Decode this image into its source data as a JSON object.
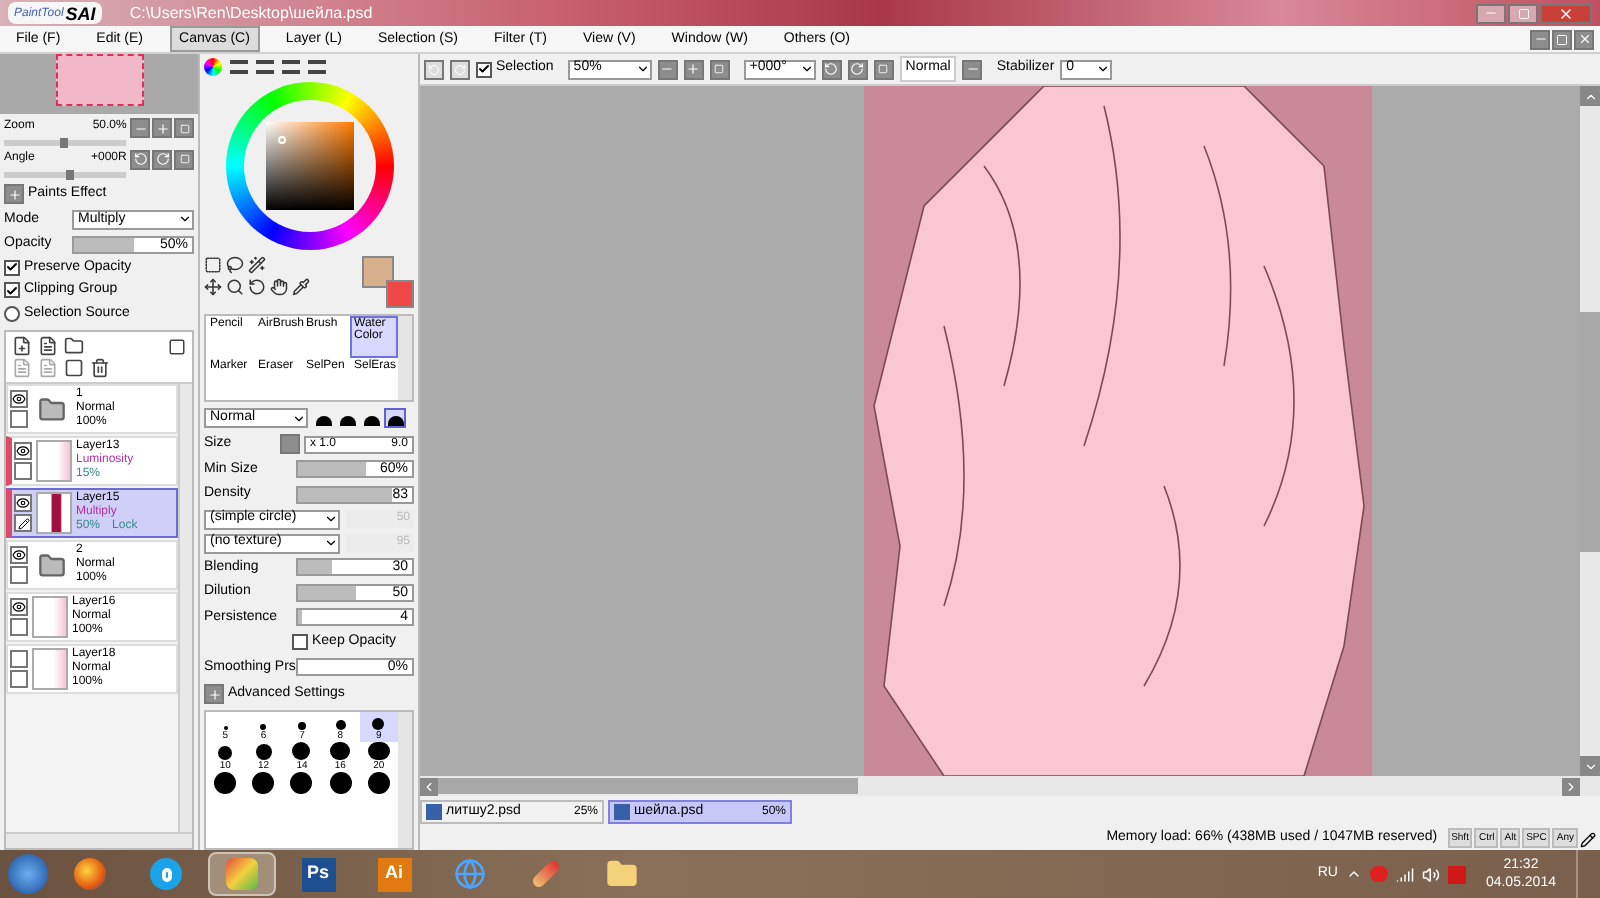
{
  "window": {
    "logo_small": "PaintTool",
    "logo_big": "SAI",
    "title": "C:\\Users\\Ren\\Desktop\\шейла.psd"
  },
  "menu": [
    {
      "label": "File (F)",
      "selected": false
    },
    {
      "label": "Edit (E)",
      "selected": false
    },
    {
      "label": "Canvas (C)",
      "selected": true
    },
    {
      "label": "Layer (L)",
      "selected": false
    },
    {
      "label": "Selection (S)",
      "selected": false
    },
    {
      "label": "Filter (T)",
      "selected": false
    },
    {
      "label": "View (V)",
      "selected": false
    },
    {
      "label": "Window (W)",
      "selected": false
    },
    {
      "label": "Others (O)",
      "selected": false
    }
  ],
  "toolbar": {
    "selection": {
      "label": "Selection",
      "checked": true
    },
    "zoom": "50%",
    "angle": "+000°",
    "blend": "Normal",
    "stabilizer_label": "Stabilizer",
    "stabilizer": "0"
  },
  "navigator": {
    "zoom": {
      "label": "Zoom",
      "value": "50.0%",
      "level": 0.45
    },
    "angle": {
      "label": "Angle",
      "value": "+000R",
      "level": 0.5
    }
  },
  "layer_properties": {
    "title": "Paints Effect",
    "mode_label": "Mode",
    "mode": "Multiply",
    "opacity": {
      "label": "Opacity",
      "value": "50%",
      "level": 0.5
    },
    "options": [
      {
        "kind": "checkbox",
        "label": "Preserve Opacity",
        "checked": true
      },
      {
        "kind": "checkbox",
        "label": "Clipping Group",
        "checked": true
      },
      {
        "kind": "radio",
        "label": "Selection Source",
        "checked": false
      }
    ]
  },
  "layers": [
    {
      "kind": "folder",
      "name": "1",
      "mode": "Normal",
      "opacity": "100%",
      "visible": true,
      "clipped": false,
      "selected": false
    },
    {
      "kind": "layer",
      "name": "Layer13",
      "mode": "Luminosity",
      "opacity": "15%",
      "visible": true,
      "clipped": true,
      "selected": false
    },
    {
      "kind": "layer",
      "name": "Layer15",
      "mode": "Multiply",
      "opacity": "50%",
      "lock": "Lock",
      "visible": true,
      "clipped": true,
      "selected": true
    },
    {
      "kind": "folder",
      "name": "2",
      "mode": "Normal",
      "opacity": "100%",
      "visible": true,
      "clipped": false,
      "selected": false
    },
    {
      "kind": "layer",
      "name": "Layer16",
      "mode": "Normal",
      "opacity": "100%",
      "visible": true,
      "clipped": false,
      "selected": false
    },
    {
      "kind": "layer",
      "name": "Layer18",
      "mode": "Normal",
      "opacity": "100%",
      "visible": false,
      "clipped": false,
      "selected": false
    }
  ],
  "brush_tools": [
    {
      "label": "Pencil",
      "selected": false
    },
    {
      "label": "AirBrush",
      "selected": false
    },
    {
      "label": "Brush",
      "selected": false
    },
    {
      "label": "Water Color",
      "selected": true
    },
    {
      "label": "Marker",
      "selected": false
    },
    {
      "label": "Eraser",
      "selected": false
    },
    {
      "label": "SelPen",
      "selected": false
    },
    {
      "label": "SelEras",
      "selected": false
    }
  ],
  "brush_settings": {
    "blend": "Normal",
    "tip_shapes": [
      {
        "selected": false
      },
      {
        "selected": false
      },
      {
        "selected": false
      },
      {
        "selected": true
      }
    ],
    "size_label": "Size",
    "size_multiplier": "x 1.0",
    "size": "9.0",
    "rows": [
      {
        "kind": "slider",
        "label": "Min Size",
        "value": "60%",
        "level": 0.6
      },
      {
        "kind": "slider",
        "label": "Density",
        "value": "83",
        "level": 0.83
      },
      {
        "kind": "dropdown",
        "label": "(simple circle)",
        "value": "50",
        "disabled": true
      },
      {
        "kind": "dropdown",
        "label": "(no texture)",
        "value": "95",
        "disabled": true
      },
      {
        "kind": "slider",
        "label": "Blending",
        "value": "30",
        "level": 0.3
      },
      {
        "kind": "slider",
        "label": "Dilution",
        "value": "50",
        "level": 0.5
      },
      {
        "kind": "slider",
        "label": "Persistence",
        "value": "4",
        "level": 0.04
      },
      {
        "kind": "checkbox",
        "label": "Keep Opacity",
        "checked": false
      },
      {
        "kind": "slider",
        "label": "Smoothing Prs",
        "value": "0%"
      }
    ],
    "advanced": "Advanced Settings"
  },
  "brush_sizes": [
    {
      "label": "5",
      "selected": false
    },
    {
      "label": "6",
      "selected": false
    },
    {
      "label": "7",
      "selected": false
    },
    {
      "label": "8",
      "selected": false
    },
    {
      "label": "9",
      "selected": true
    },
    {
      "label": "10",
      "selected": false
    },
    {
      "label": "12",
      "selected": false
    },
    {
      "label": "14",
      "selected": false
    },
    {
      "label": "16",
      "selected": false
    },
    {
      "label": "20",
      "selected": false
    }
  ],
  "documents": [
    {
      "name": "литшу2.psd",
      "zoom": "25%",
      "selected": false
    },
    {
      "name": "шейла.psd",
      "zoom": "50%",
      "selected": true
    }
  ],
  "status": {
    "memory": "Memory load: 66% (438MB used / 1047MB reserved)",
    "keys": [
      "Shft",
      "Ctrl",
      "Alt",
      "SPC",
      "Any"
    ]
  },
  "taskbar": {
    "apps": [
      {
        "kind": "browser",
        "active": false
      },
      {
        "kind": "chat",
        "active": false
      },
      {
        "kind": "paint",
        "active": true
      },
      {
        "kind": "text",
        "label": "Ps",
        "color": "#1d4f91",
        "active": false
      },
      {
        "kind": "text",
        "label": "Ai",
        "color": "#e07a10",
        "active": false
      },
      {
        "kind": "globe",
        "active": false
      },
      {
        "kind": "brush",
        "active": false
      },
      {
        "kind": "folder",
        "active": false
      }
    ],
    "language": "RU",
    "time": "21:32",
    "date": "04.05.2014"
  }
}
